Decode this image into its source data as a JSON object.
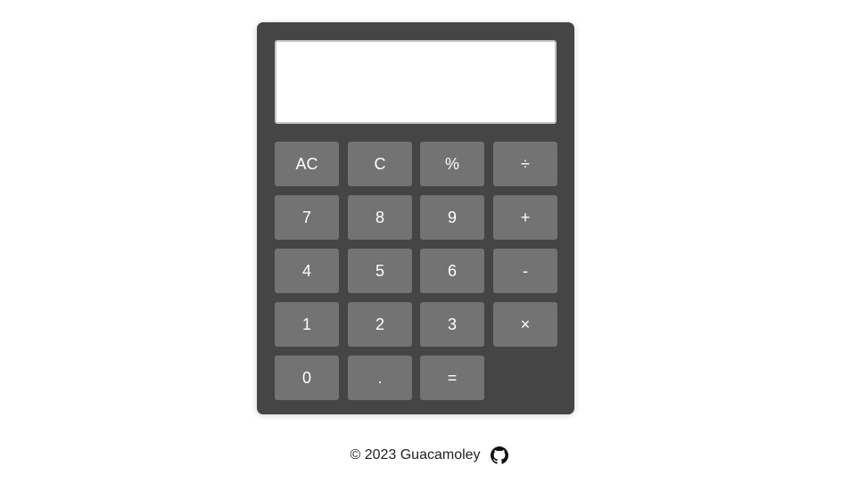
{
  "display": {
    "value": "",
    "placeholder": ""
  },
  "keys": [
    {
      "label": "AC",
      "name": "all-clear-button",
      "row": 0,
      "col": 0
    },
    {
      "label": "C",
      "name": "clear-button",
      "row": 0,
      "col": 1
    },
    {
      "label": "%",
      "name": "percent-button",
      "row": 0,
      "col": 2
    },
    {
      "label": "÷",
      "name": "divide-button",
      "row": 0,
      "col": 3
    },
    {
      "label": "7",
      "name": "digit-7-button",
      "row": 1,
      "col": 0
    },
    {
      "label": "8",
      "name": "digit-8-button",
      "row": 1,
      "col": 1
    },
    {
      "label": "9",
      "name": "digit-9-button",
      "row": 1,
      "col": 2
    },
    {
      "label": "+",
      "name": "add-button",
      "row": 1,
      "col": 3
    },
    {
      "label": "4",
      "name": "digit-4-button",
      "row": 2,
      "col": 0
    },
    {
      "label": "5",
      "name": "digit-5-button",
      "row": 2,
      "col": 1
    },
    {
      "label": "6",
      "name": "digit-6-button",
      "row": 2,
      "col": 2
    },
    {
      "label": "-",
      "name": "subtract-button",
      "row": 2,
      "col": 3
    },
    {
      "label": "1",
      "name": "digit-1-button",
      "row": 3,
      "col": 0
    },
    {
      "label": "2",
      "name": "digit-2-button",
      "row": 3,
      "col": 1
    },
    {
      "label": "3",
      "name": "digit-3-button",
      "row": 3,
      "col": 2
    },
    {
      "label": "×",
      "name": "multiply-button",
      "row": 3,
      "col": 3
    },
    {
      "label": "0",
      "name": "digit-0-button",
      "row": 4,
      "col": 0
    },
    {
      "label": ".",
      "name": "decimal-button",
      "row": 4,
      "col": 1
    },
    {
      "label": "=",
      "name": "equals-button",
      "row": 4,
      "col": 2
    }
  ],
  "footer": {
    "copyright": "© 2023 Guacamoley",
    "icon": "github-icon"
  },
  "colors": {
    "body_bg": "#454545",
    "key_bg": "#737373",
    "key_text": "#ffffff",
    "display_bg": "#ffffff",
    "page_bg": "#ffffff"
  }
}
